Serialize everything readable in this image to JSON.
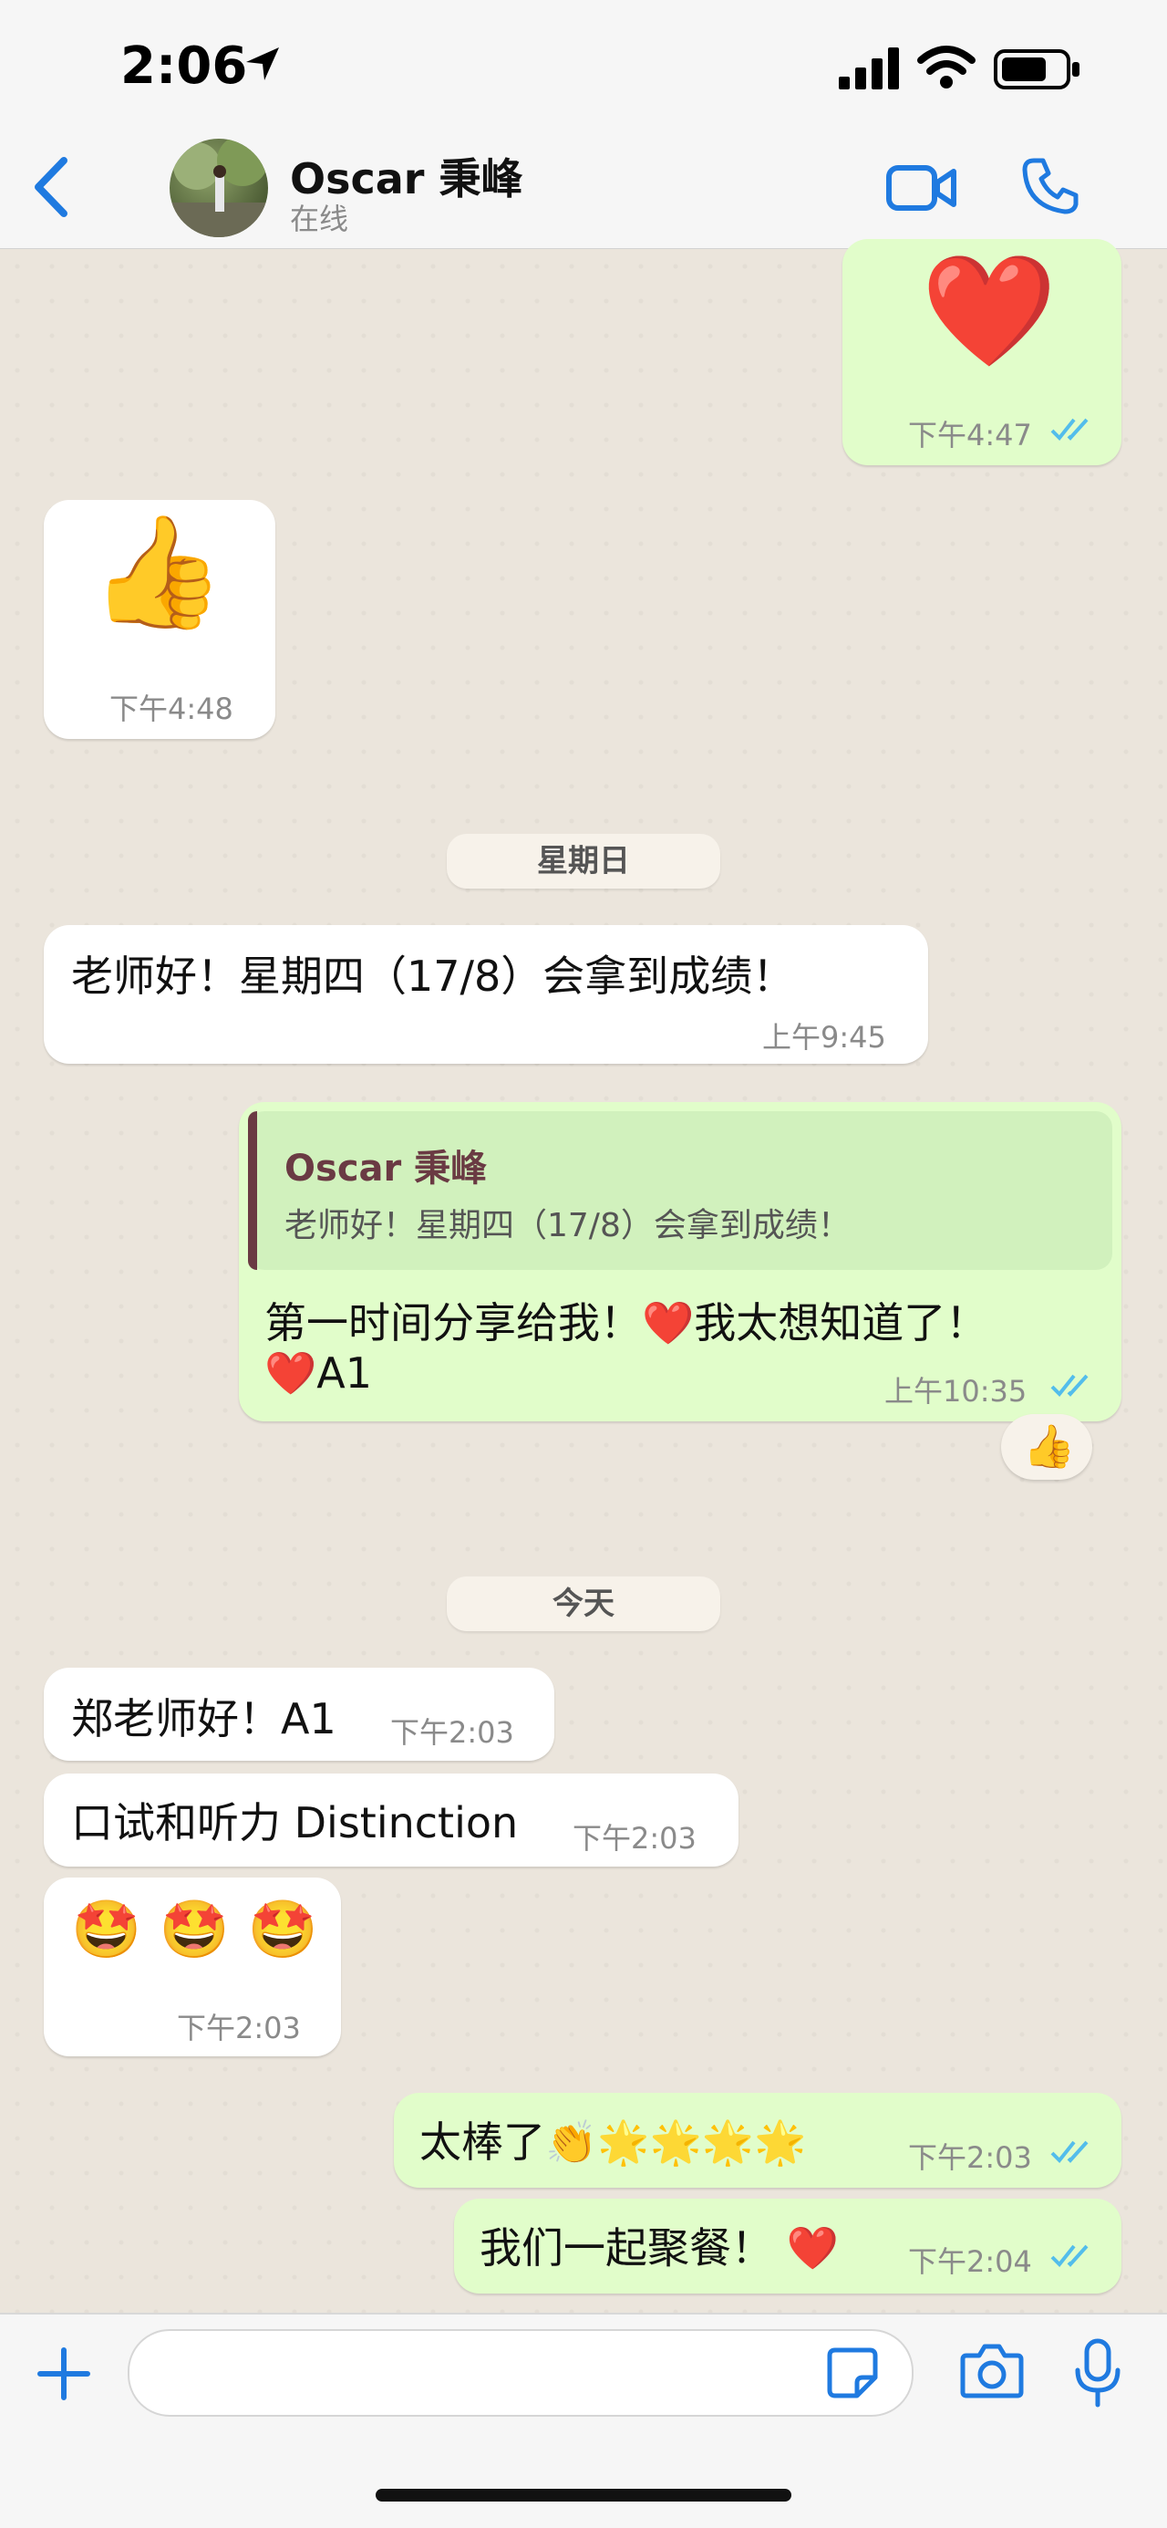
{
  "status_bar": {
    "time": "2:06"
  },
  "header": {
    "contact_name": "Oscar 秉峰",
    "contact_status": "在线"
  },
  "messages": {
    "m1": {
      "emoji": "❤️",
      "time": "下午4:47"
    },
    "m2": {
      "emoji": "👍",
      "time": "下午4:48"
    },
    "day1": "星期日",
    "m3": {
      "text": "老师好！星期四（17/8）会拿到成绩！",
      "time": "上午9:45"
    },
    "m4": {
      "quote_author": "Oscar 秉峰",
      "quote_text": "老师好！星期四（17/8）会拿到成绩！",
      "line1": "第一时间分享给我！❤️我太想知道了！",
      "line2": "❤️A1",
      "time": "上午10:35",
      "reaction": "👍"
    },
    "day2": "今天",
    "m5": {
      "text": "郑老师好！A1",
      "time": "下午2:03"
    },
    "m6": {
      "text": "口试和听力 Distinction",
      "time": "下午2:03"
    },
    "m7": {
      "emoji": "🤩 🤩 🤩",
      "time": "下午2:03"
    },
    "m8": {
      "text": "太棒了👏🌟🌟🌟🌟",
      "time": "下午2:03"
    },
    "m9": {
      "text": "我们一起聚餐！ ❤️",
      "time": "下午2:04"
    }
  },
  "composer": {
    "placeholder": ""
  },
  "colors": {
    "accent": "#1f7ae0",
    "outgoing": "#e1fdca",
    "incoming": "#ffffff",
    "read_ticks": "#53bdeb",
    "quote_author": "#6a3a43"
  },
  "icons": [
    "location-arrow-icon",
    "signal-icon",
    "wifi-icon",
    "battery-icon",
    "back-chevron-icon",
    "video-call-icon",
    "phone-icon",
    "plus-icon",
    "sticker-icon",
    "camera-icon",
    "microphone-icon"
  ]
}
